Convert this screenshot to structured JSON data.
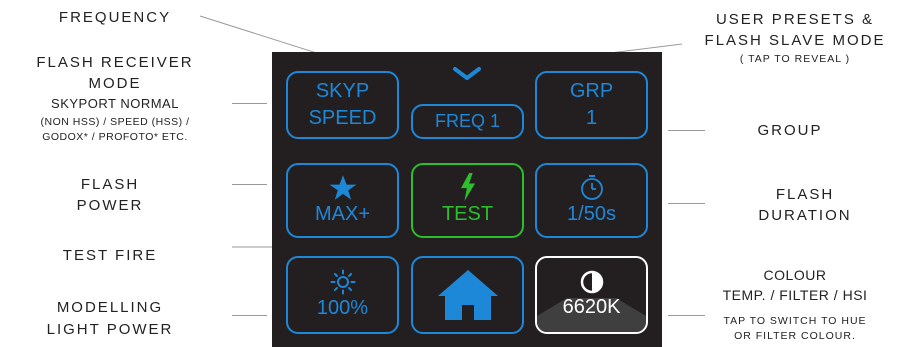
{
  "colors": {
    "blue": "#1e88d8",
    "green": "#2bbf2b",
    "screen_bg": "#231f20",
    "white": "#ffffff"
  },
  "labels": {
    "frequency": "FREQUENCY",
    "presets_line1": "USER PRESETS &",
    "presets_line2": "FLASH SLAVE MODE",
    "presets_note": "( TAP TO REVEAL )",
    "receiver_line1": "FLASH RECEIVER",
    "receiver_line2": "MODE",
    "receiver_sub1": "SKYPORT NORMAL",
    "receiver_sub2": "(NON HSS) / SPEED (HSS) /",
    "receiver_sub3": "GODOX* / PROFOTO* ETC.",
    "group": "GROUP",
    "flash_power_line1": "FLASH",
    "flash_power_line2": "POWER",
    "flash_duration_line1": "FLASH",
    "flash_duration_line2": "DURATION",
    "test_fire": "TEST FIRE",
    "modelling_line1": "MODELLING",
    "modelling_line2": "LIGHT POWER",
    "colour_line1": "COLOUR",
    "colour_line2": "TEMP. / FILTER / HSI",
    "colour_note1": "TAP TO SWITCH TO HUE",
    "colour_note2": "OR FILTER COLOUR."
  },
  "tiles": {
    "skyp": {
      "line1": "SKYP",
      "line2": "SPEED"
    },
    "freq": {
      "label": "FREQ 1"
    },
    "grp": {
      "line1": "GRP",
      "line2": "1"
    },
    "power": {
      "icon": "star-icon",
      "label": "MAX+"
    },
    "test": {
      "icon": "lightning-icon",
      "label": "TEST"
    },
    "duration": {
      "icon": "stopwatch-icon",
      "label": "1/50s"
    },
    "modelling": {
      "icon": "sun-icon",
      "label": "100%"
    },
    "home": {
      "icon": "home-icon"
    },
    "colour": {
      "icon": "half-circle-icon",
      "label": "6620K"
    }
  }
}
